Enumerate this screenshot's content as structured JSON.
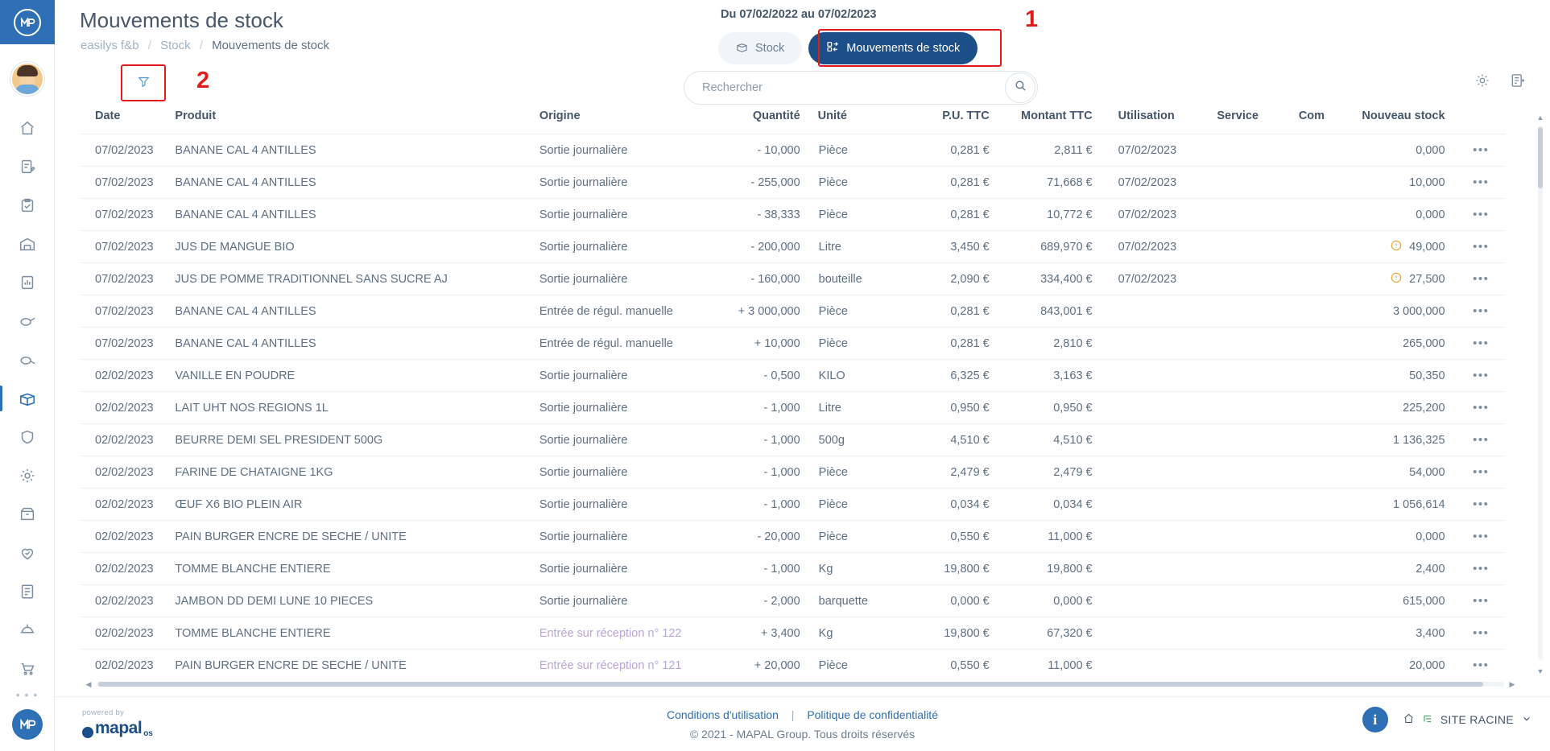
{
  "app": {
    "logo_initials": "M",
    "brand_color": "#1c4f87",
    "accent_color": "#2f6fb5",
    "annotation_color": "#e01b1b"
  },
  "sidebar": {
    "items": [
      {
        "name": "home",
        "icon": "home-icon",
        "active": false
      },
      {
        "name": "orders",
        "icon": "edit-document-icon",
        "active": false
      },
      {
        "name": "tasks",
        "icon": "clipboard-check-icon",
        "active": false
      },
      {
        "name": "deliveries",
        "icon": "warehouse-icon",
        "active": false
      },
      {
        "name": "reports",
        "icon": "chart-document-icon",
        "active": false
      },
      {
        "name": "recipes",
        "icon": "pan-icon",
        "active": false
      },
      {
        "name": "production",
        "icon": "pan-alt-icon",
        "active": false
      },
      {
        "name": "stock",
        "icon": "box-open-icon",
        "active": true
      },
      {
        "name": "quality",
        "icon": "shield-icon",
        "active": false
      },
      {
        "name": "settings",
        "icon": "gear-icon",
        "active": false
      },
      {
        "name": "inventory",
        "icon": "box-icon",
        "active": false
      },
      {
        "name": "favorites",
        "icon": "heart-check-icon",
        "active": false
      },
      {
        "name": "invoices",
        "icon": "invoice-icon",
        "active": false
      },
      {
        "name": "suppliers",
        "icon": "delivery-icon",
        "active": false
      },
      {
        "name": "cart",
        "icon": "cart-icon",
        "active": false
      }
    ],
    "avatar_name": "avatar",
    "more_dots": "• • •"
  },
  "header": {
    "title": "Mouvements de stock",
    "breadcrumb": [
      {
        "label": "easilys f&b",
        "current": false
      },
      {
        "label": "Stock",
        "current": false
      },
      {
        "label": "Mouvements de stock",
        "current": true
      }
    ],
    "breadcrumb_separator": "/",
    "date_range": "Du 07/02/2022 au 07/02/2023",
    "toggles": [
      {
        "label": "Stock",
        "icon": "box-icon",
        "active": false
      },
      {
        "label": "Mouvements de stock",
        "icon": "movement-icon",
        "active": true
      }
    ],
    "search": {
      "placeholder": "Rechercher",
      "value": "",
      "icon": "search-icon"
    },
    "filter_icon": "filter-funnel-icon",
    "right_icons": [
      {
        "name": "gear-icon"
      },
      {
        "name": "export-report-icon"
      }
    ],
    "annotations": [
      {
        "number": "1",
        "target": "mouvements-de-stock-toggle"
      },
      {
        "number": "2",
        "target": "filter-button"
      }
    ]
  },
  "table": {
    "columns": [
      {
        "key": "date",
        "label": "Date"
      },
      {
        "key": "produit",
        "label": "Produit"
      },
      {
        "key": "origine",
        "label": "Origine"
      },
      {
        "key": "quantite",
        "label": "Quantité"
      },
      {
        "key": "unite",
        "label": "Unité"
      },
      {
        "key": "pu_ttc",
        "label": "P.U. TTC"
      },
      {
        "key": "montant_ttc",
        "label": "Montant TTC"
      },
      {
        "key": "utilisation",
        "label": "Utilisation"
      },
      {
        "key": "service",
        "label": "Service"
      },
      {
        "key": "com",
        "label": "Com"
      },
      {
        "key": "nouveau_stock",
        "label": "Nouveau stock"
      }
    ],
    "row_menu_glyph": "•••",
    "rows": [
      {
        "date": "07/02/2023",
        "produit": "BANANE CAL 4 ANTILLES",
        "origine": "Sortie journalière",
        "origine_link": false,
        "quantite": "- 10,000",
        "unite": "Pièce",
        "pu_ttc": "0,281 €",
        "montant_ttc": "2,811 €",
        "utilisation": "07/02/2023",
        "service": "",
        "com": "",
        "nouveau_stock": "0,000",
        "warn": false
      },
      {
        "date": "07/02/2023",
        "produit": "BANANE CAL 4 ANTILLES",
        "origine": "Sortie journalière",
        "origine_link": false,
        "quantite": "- 255,000",
        "unite": "Pièce",
        "pu_ttc": "0,281 €",
        "montant_ttc": "71,668 €",
        "utilisation": "07/02/2023",
        "service": "",
        "com": "",
        "nouveau_stock": "10,000",
        "warn": false
      },
      {
        "date": "07/02/2023",
        "produit": "BANANE CAL 4 ANTILLES",
        "origine": "Sortie journalière",
        "origine_link": false,
        "quantite": "- 38,333",
        "unite": "Pièce",
        "pu_ttc": "0,281 €",
        "montant_ttc": "10,772 €",
        "utilisation": "07/02/2023",
        "service": "",
        "com": "",
        "nouveau_stock": "0,000",
        "warn": false
      },
      {
        "date": "07/02/2023",
        "produit": "JUS DE MANGUE BIO",
        "origine": "Sortie journalière",
        "origine_link": false,
        "quantite": "- 200,000",
        "unite": "Litre",
        "pu_ttc": "3,450 €",
        "montant_ttc": "689,970 €",
        "utilisation": "07/02/2023",
        "service": "",
        "com": "",
        "nouveau_stock": "49,000",
        "warn": true
      },
      {
        "date": "07/02/2023",
        "produit": "JUS DE POMME TRADITIONNEL SANS SUCRE AJ",
        "origine": "Sortie journalière",
        "origine_link": false,
        "quantite": "- 160,000",
        "unite": "bouteille",
        "pu_ttc": "2,090 €",
        "montant_ttc": "334,400 €",
        "utilisation": "07/02/2023",
        "service": "",
        "com": "",
        "nouveau_stock": "27,500",
        "warn": true
      },
      {
        "date": "07/02/2023",
        "produit": "BANANE CAL 4 ANTILLES",
        "origine": "Entrée de régul. manuelle",
        "origine_link": false,
        "quantite": "+ 3 000,000",
        "unite": "Pièce",
        "pu_ttc": "0,281 €",
        "montant_ttc": "843,001 €",
        "utilisation": "",
        "service": "",
        "com": "",
        "nouveau_stock": "3 000,000",
        "warn": false
      },
      {
        "date": "07/02/2023",
        "produit": "BANANE CAL 4 ANTILLES",
        "origine": "Entrée de régul. manuelle",
        "origine_link": false,
        "quantite": "+ 10,000",
        "unite": "Pièce",
        "pu_ttc": "0,281 €",
        "montant_ttc": "2,810 €",
        "utilisation": "",
        "service": "",
        "com": "",
        "nouveau_stock": "265,000",
        "warn": false
      },
      {
        "date": "02/02/2023",
        "produit": "VANILLE EN POUDRE",
        "origine": "Sortie journalière",
        "origine_link": false,
        "quantite": "- 0,500",
        "unite": "KILO",
        "pu_ttc": "6,325 €",
        "montant_ttc": "3,163 €",
        "utilisation": "",
        "service": "",
        "com": "",
        "nouveau_stock": "50,350",
        "warn": false
      },
      {
        "date": "02/02/2023",
        "produit": "LAIT UHT NOS REGIONS 1L",
        "origine": "Sortie journalière",
        "origine_link": false,
        "quantite": "- 1,000",
        "unite": "Litre",
        "pu_ttc": "0,950 €",
        "montant_ttc": "0,950 €",
        "utilisation": "",
        "service": "",
        "com": "",
        "nouveau_stock": "225,200",
        "warn": false
      },
      {
        "date": "02/02/2023",
        "produit": "BEURRE DEMI SEL PRESIDENT 500G",
        "origine": "Sortie journalière",
        "origine_link": false,
        "quantite": "- 1,000",
        "unite": "500g",
        "pu_ttc": "4,510 €",
        "montant_ttc": "4,510 €",
        "utilisation": "",
        "service": "",
        "com": "",
        "nouveau_stock": "1 136,325",
        "warn": false
      },
      {
        "date": "02/02/2023",
        "produit": "FARINE DE CHATAIGNE 1KG",
        "origine": "Sortie journalière",
        "origine_link": false,
        "quantite": "- 1,000",
        "unite": "Pièce",
        "pu_ttc": "2,479 €",
        "montant_ttc": "2,479 €",
        "utilisation": "",
        "service": "",
        "com": "",
        "nouveau_stock": "54,000",
        "warn": false
      },
      {
        "date": "02/02/2023",
        "produit": "ŒUF X6 BIO PLEIN AIR",
        "origine": "Sortie journalière",
        "origine_link": false,
        "quantite": "- 1,000",
        "unite": "Pièce",
        "pu_ttc": "0,034 €",
        "montant_ttc": "0,034 €",
        "utilisation": "",
        "service": "",
        "com": "",
        "nouveau_stock": "1 056,614",
        "warn": false
      },
      {
        "date": "02/02/2023",
        "produit": "PAIN BURGER ENCRE DE SECHE / UNITE",
        "origine": "Sortie journalière",
        "origine_link": false,
        "quantite": "- 20,000",
        "unite": "Pièce",
        "pu_ttc": "0,550 €",
        "montant_ttc": "11,000 €",
        "utilisation": "",
        "service": "",
        "com": "",
        "nouveau_stock": "0,000",
        "warn": false
      },
      {
        "date": "02/02/2023",
        "produit": "TOMME BLANCHE ENTIERE",
        "origine": "Sortie journalière",
        "origine_link": false,
        "quantite": "- 1,000",
        "unite": "Kg",
        "pu_ttc": "19,800 €",
        "montant_ttc": "19,800 €",
        "utilisation": "",
        "service": "",
        "com": "",
        "nouveau_stock": "2,400",
        "warn": false
      },
      {
        "date": "02/02/2023",
        "produit": "JAMBON DD DEMI LUNE 10 PIECES",
        "origine": "Sortie journalière",
        "origine_link": false,
        "quantite": "- 2,000",
        "unite": "barquette",
        "pu_ttc": "0,000 €",
        "montant_ttc": "0,000 €",
        "utilisation": "",
        "service": "",
        "com": "",
        "nouveau_stock": "615,000",
        "warn": false
      },
      {
        "date": "02/02/2023",
        "produit": "TOMME BLANCHE ENTIERE",
        "origine": "Entrée sur réception n° 122",
        "origine_link": true,
        "quantite": "+ 3,400",
        "unite": "Kg",
        "pu_ttc": "19,800 €",
        "montant_ttc": "67,320 €",
        "utilisation": "",
        "service": "",
        "com": "",
        "nouveau_stock": "3,400",
        "warn": false
      },
      {
        "date": "02/02/2023",
        "produit": "PAIN BURGER ENCRE DE SECHE / UNITE",
        "origine": "Entrée sur réception n° 121",
        "origine_link": true,
        "quantite": "+ 20,000",
        "unite": "Pièce",
        "pu_ttc": "0,550 €",
        "montant_ttc": "11,000 €",
        "utilisation": "",
        "service": "",
        "com": "",
        "nouveau_stock": "20,000",
        "warn": false
      }
    ]
  },
  "footer": {
    "powered_by": "powered by",
    "logo_text": "mapal",
    "logo_sup": "os",
    "links": [
      {
        "label": "Conditions d'utilisation"
      },
      {
        "label": "Politique de confidentialité"
      }
    ],
    "link_separator": "|",
    "copyright": "© 2021 - MAPAL Group. Tous droits réservés",
    "info_glyph": "i",
    "site_selector": {
      "label": "SITE RACINE",
      "home_icon": "home-icon",
      "chevron_icon": "chevron-down-icon"
    }
  }
}
